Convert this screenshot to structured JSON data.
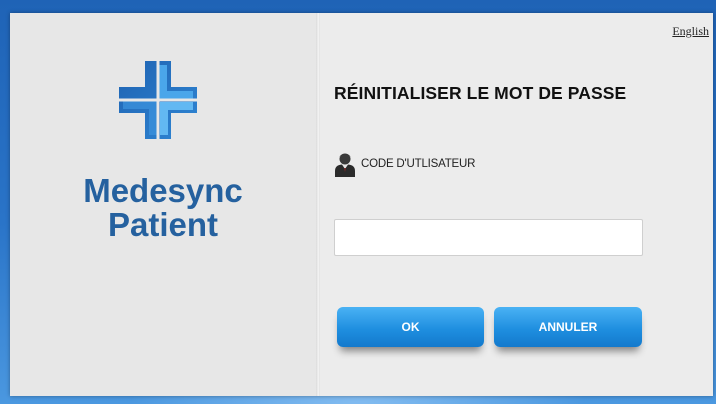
{
  "app": {
    "brand_line1": "Medesync",
    "brand_line2": "Patient"
  },
  "header": {
    "language_link": "English"
  },
  "form": {
    "title": "RÉINITIALISER LE MOT DE PASSE",
    "user_code_label": "CODE D'UTLISATEUR",
    "user_code_value": "",
    "user_code_placeholder": ""
  },
  "buttons": {
    "ok_label": "OK",
    "cancel_label": "ANNULER"
  },
  "icons": {
    "logo": "medical-cross-icon",
    "user": "user-icon"
  },
  "colors": {
    "brand_text": "#25619f",
    "logo_dark": "#1f63b2",
    "logo_light": "#4aa6ea",
    "button": "#1f8fe0"
  }
}
